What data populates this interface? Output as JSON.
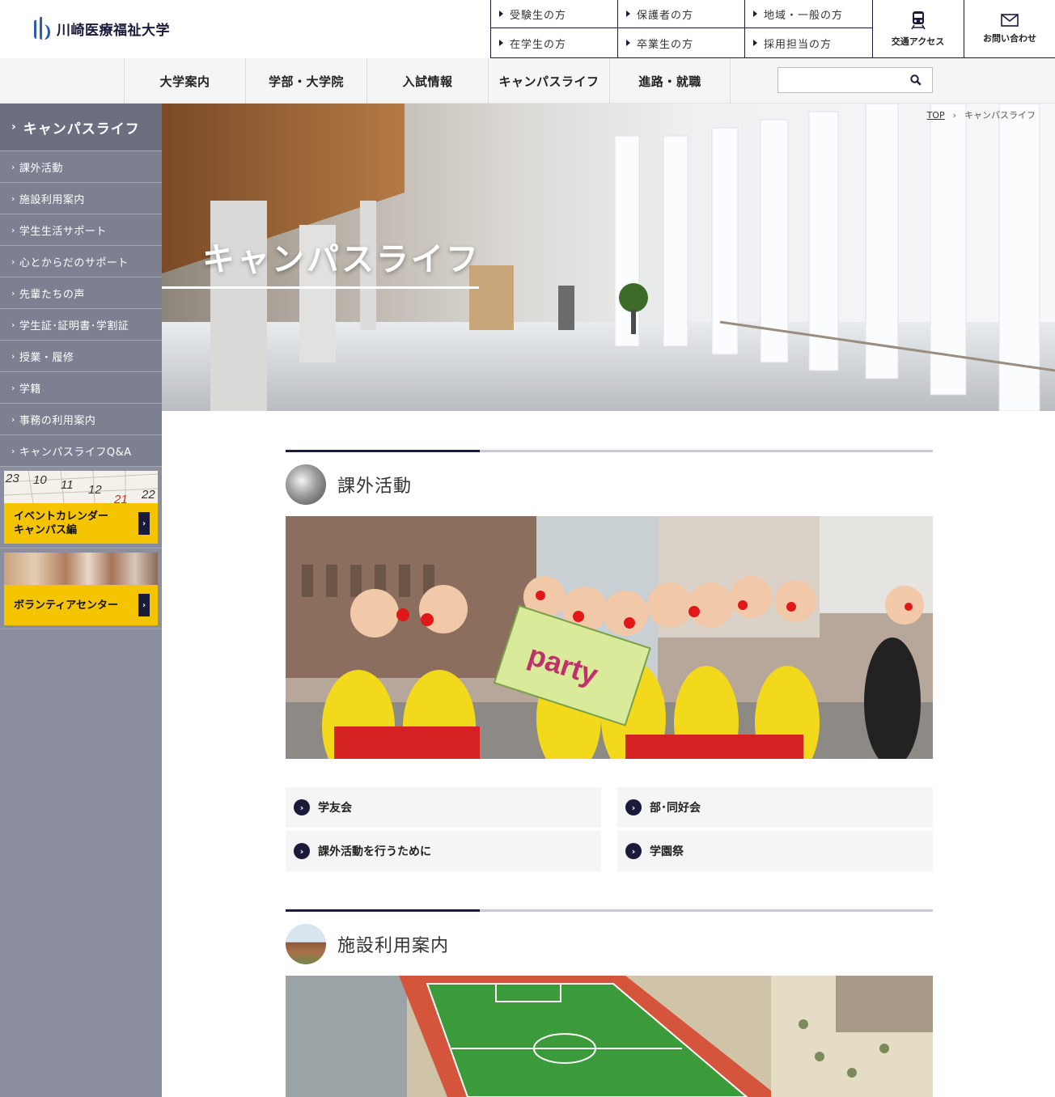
{
  "brand": {
    "name": "川崎医療福祉大学",
    "color": "#1a1a3a",
    "accent": "#f5c400"
  },
  "audience_links": [
    {
      "label": "受験生の方"
    },
    {
      "label": "保護者の方"
    },
    {
      "label": "地域・一般の方"
    },
    {
      "label": "在学生の方"
    },
    {
      "label": "卒業生の方"
    },
    {
      "label": "採用担当の方"
    }
  ],
  "utility": {
    "access_label": "交通アクセス",
    "access_icon": "train-icon",
    "contact_label": "お問い合わせ",
    "contact_icon": "mail-icon"
  },
  "global_nav": [
    {
      "label": "大学案内"
    },
    {
      "label": "学部・大学院"
    },
    {
      "label": "入試情報"
    },
    {
      "label": "キャンパスライフ"
    },
    {
      "label": "進路・就職"
    }
  ],
  "search": {
    "placeholder": "",
    "value": "",
    "icon": "search-icon"
  },
  "sidebar": {
    "heading": "キャンパスライフ",
    "items": [
      {
        "label": "課外活動"
      },
      {
        "label": "施設利用案内"
      },
      {
        "label": "学生生活サポート"
      },
      {
        "label": "心とからだのサポート"
      },
      {
        "label": "先輩たちの声"
      },
      {
        "label": "学生証･証明書･学割証"
      },
      {
        "label": "授業・履修"
      },
      {
        "label": "学籍"
      },
      {
        "label": "事務の利用案内"
      },
      {
        "label": "キャンパスライフQ&A"
      }
    ],
    "banners": [
      {
        "line1": "イベントカレンダー",
        "line2": "キャンパス編",
        "calendar_numbers": [
          "23",
          "10",
          "11",
          "12",
          "21",
          "22"
        ]
      },
      {
        "line1": "ボランティアセンター",
        "line2": ""
      }
    ]
  },
  "breadcrumb": {
    "home": "TOP",
    "current": "キャンパスライフ"
  },
  "hero": {
    "title": "キャンパスライフ"
  },
  "sections": [
    {
      "title": "課外活動",
      "photo_banner_text": "party",
      "links": [
        {
          "label": "学友会"
        },
        {
          "label": "部･同好会"
        },
        {
          "label": "課外活動を行うために"
        },
        {
          "label": "学園祭"
        }
      ]
    },
    {
      "title": "施設利用案内"
    }
  ]
}
